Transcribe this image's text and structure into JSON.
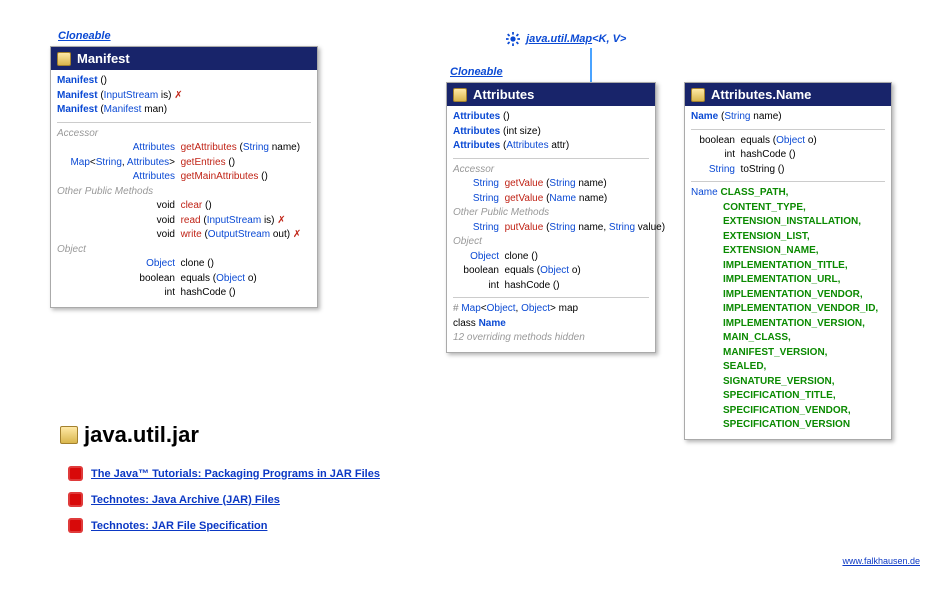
{
  "interfaces": {
    "cloneable_manifest": "Cloneable",
    "cloneable_attributes": "Cloneable",
    "map_label_prefix": "java.util.",
    "map_label_main": "Map",
    "map_label_generics": "<K, V>"
  },
  "manifest": {
    "title": "Manifest",
    "ctors": [
      {
        "name": "Manifest",
        "params": "()"
      },
      {
        "name": "Manifest",
        "params": "(InputStream is)",
        "throws": true
      },
      {
        "name": "Manifest",
        "params": "(Manifest man)"
      }
    ],
    "sections": {
      "accessor_label": "Accessor",
      "other_label": "Other Public Methods",
      "object_label": "Object"
    },
    "accessor": [
      {
        "ret": "Attributes",
        "name": "getAttributes",
        "params": "(String name)"
      },
      {
        "ret": "Map<String, Attributes>",
        "name": "getEntries",
        "params": "()"
      },
      {
        "ret": "Attributes",
        "name": "getMainAttributes",
        "params": "()"
      }
    ],
    "other": [
      {
        "ret": "void",
        "name": "clear",
        "params": "()"
      },
      {
        "ret": "void",
        "name": "read",
        "params": "(InputStream is)",
        "throws": true
      },
      {
        "ret": "void",
        "name": "write",
        "params": "(OutputStream out)",
        "throws": true
      }
    ],
    "object": [
      {
        "ret": "Object",
        "name": "clone",
        "params": "()"
      },
      {
        "ret": "boolean",
        "name": "equals",
        "params": "(Object o)"
      },
      {
        "ret": "int",
        "name": "hashCode",
        "params": "()"
      }
    ]
  },
  "attributes": {
    "title": "Attributes",
    "ctors": [
      {
        "name": "Attributes",
        "params": "()"
      },
      {
        "name": "Attributes",
        "params": "(int size)"
      },
      {
        "name": "Attributes",
        "params": "(Attributes attr)"
      }
    ],
    "sections": {
      "accessor_label": "Accessor",
      "other_label": "Other Public Methods",
      "object_label": "Object"
    },
    "accessor": [
      {
        "ret": "String",
        "name": "getValue",
        "params": "(String name)"
      },
      {
        "ret": "String",
        "name": "getValue",
        "params": "(Name name)"
      }
    ],
    "other": [
      {
        "ret": "String",
        "name": "putValue",
        "params": "(String name, String value)"
      }
    ],
    "object": [
      {
        "ret": "Object",
        "name": "clone",
        "params": "()"
      },
      {
        "ret": "boolean",
        "name": "equals",
        "params": "(Object o)"
      },
      {
        "ret": "int",
        "name": "hashCode",
        "params": "()"
      }
    ],
    "footer_field": "Map<Object, Object> map",
    "footer_class": "class ",
    "footer_class_name": "Name",
    "footer_note": "12 overriding methods hidden"
  },
  "attr_name": {
    "title": "Attributes.Name",
    "ctor": {
      "name": "Name",
      "params": "(String name)"
    },
    "methods": [
      {
        "ret": "boolean",
        "name": "equals",
        "params": "(Object o)"
      },
      {
        "ret": "int",
        "name": "hashCode",
        "params": "()"
      },
      {
        "ret": "String",
        "name": "toString",
        "params": "()"
      }
    ],
    "const_type": "Name",
    "consts": [
      "CLASS_PATH,",
      "CONTENT_TYPE,",
      "EXTENSION_INSTALLATION,",
      "EXTENSION_LIST,",
      "EXTENSION_NAME,",
      "IMPLEMENTATION_TITLE,",
      "IMPLEMENTATION_URL,",
      "IMPLEMENTATION_VENDOR,",
      "IMPLEMENTATION_VENDOR_ID,",
      "IMPLEMENTATION_VERSION,",
      "MAIN_CLASS,",
      "MANIFEST_VERSION,",
      "SEALED,",
      "SIGNATURE_VERSION,",
      "SPECIFICATION_TITLE,",
      "SPECIFICATION_VENDOR,",
      "SPECIFICATION_VERSION"
    ]
  },
  "package": {
    "title": "java.util.jar",
    "links": [
      "The Java™ Tutorials: Packaging Programs in JAR Files",
      "Technotes: Java Archive (JAR) Files",
      "Technotes: JAR File Specification"
    ]
  },
  "footer": "www.falkhausen.de"
}
